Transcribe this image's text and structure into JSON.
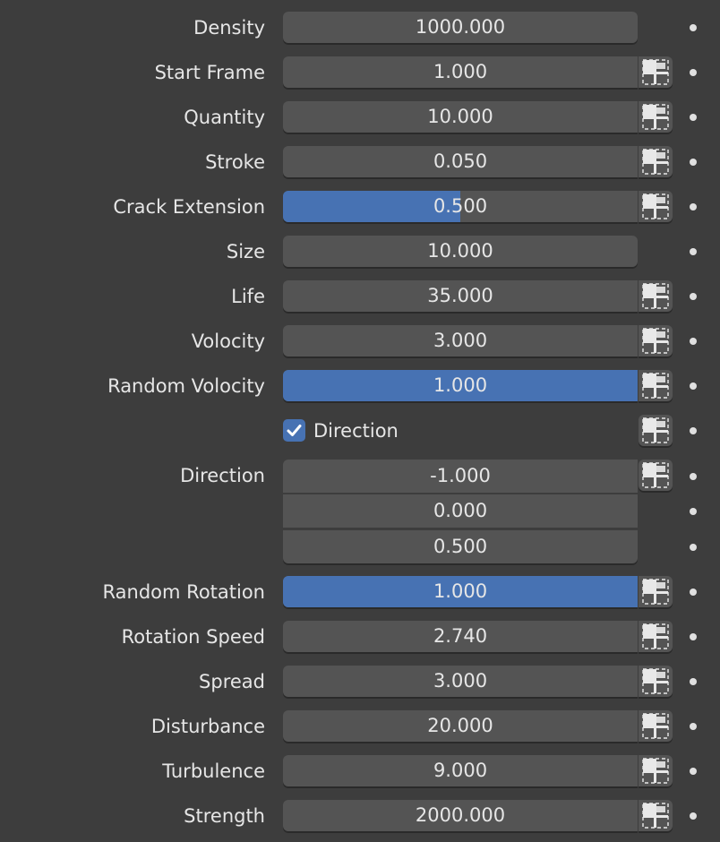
{
  "properties": [
    {
      "id": "density",
      "label": "Density",
      "value": "1000.000",
      "fill": 0,
      "keyframe": false
    },
    {
      "id": "start-frame",
      "label": "Start Frame",
      "value": "1.000",
      "fill": 0,
      "keyframe": true
    },
    {
      "id": "quantity",
      "label": "Quantity",
      "value": "10.000",
      "fill": 0,
      "keyframe": true
    },
    {
      "id": "stroke",
      "label": "Stroke",
      "value": "0.050",
      "fill": 0,
      "keyframe": true
    },
    {
      "id": "crack-extension",
      "label": "Crack Extension",
      "value": "0.500",
      "fill": 0.5,
      "keyframe": true
    },
    {
      "id": "size",
      "label": "Size",
      "value": "10.000",
      "fill": 0,
      "keyframe": false
    },
    {
      "id": "life",
      "label": "Life",
      "value": "35.000",
      "fill": 0,
      "keyframe": true
    },
    {
      "id": "volocity",
      "label": "Volocity",
      "value": "3.000",
      "fill": 0,
      "keyframe": true
    },
    {
      "id": "random-volocity",
      "label": "Random Volocity",
      "value": "1.000",
      "fill": 1.0,
      "keyframe": true
    }
  ],
  "direction_toggle": {
    "label": "Direction",
    "checked": true
  },
  "direction_vector": {
    "label": "Direction",
    "values": [
      "-1.000",
      "0.000",
      "0.500"
    ]
  },
  "properties2": [
    {
      "id": "random-rotation",
      "label": "Random Rotation",
      "value": "1.000",
      "fill": 1.0,
      "keyframe": true
    },
    {
      "id": "rotation-speed",
      "label": "Rotation Speed",
      "value": "2.740",
      "fill": 0,
      "keyframe": true
    },
    {
      "id": "spread",
      "label": "Spread",
      "value": "3.000",
      "fill": 0,
      "keyframe": true
    },
    {
      "id": "disturbance",
      "label": "Disturbance",
      "value": "20.000",
      "fill": 0,
      "keyframe": true
    },
    {
      "id": "turbulence",
      "label": "Turbulence",
      "value": "9.000",
      "fill": 0,
      "keyframe": true
    },
    {
      "id": "strength",
      "label": "Strength",
      "value": "2000.000",
      "fill": 0,
      "keyframe": true
    }
  ],
  "colors": {
    "background": "#3d3d3d",
    "field": "#545454",
    "accent": "#4772b3",
    "text": "#e6e6e6"
  },
  "icons": {
    "keyframe": "keyframe-icon",
    "decorator": "decorator-dot-icon",
    "check": "checkmark-icon"
  }
}
